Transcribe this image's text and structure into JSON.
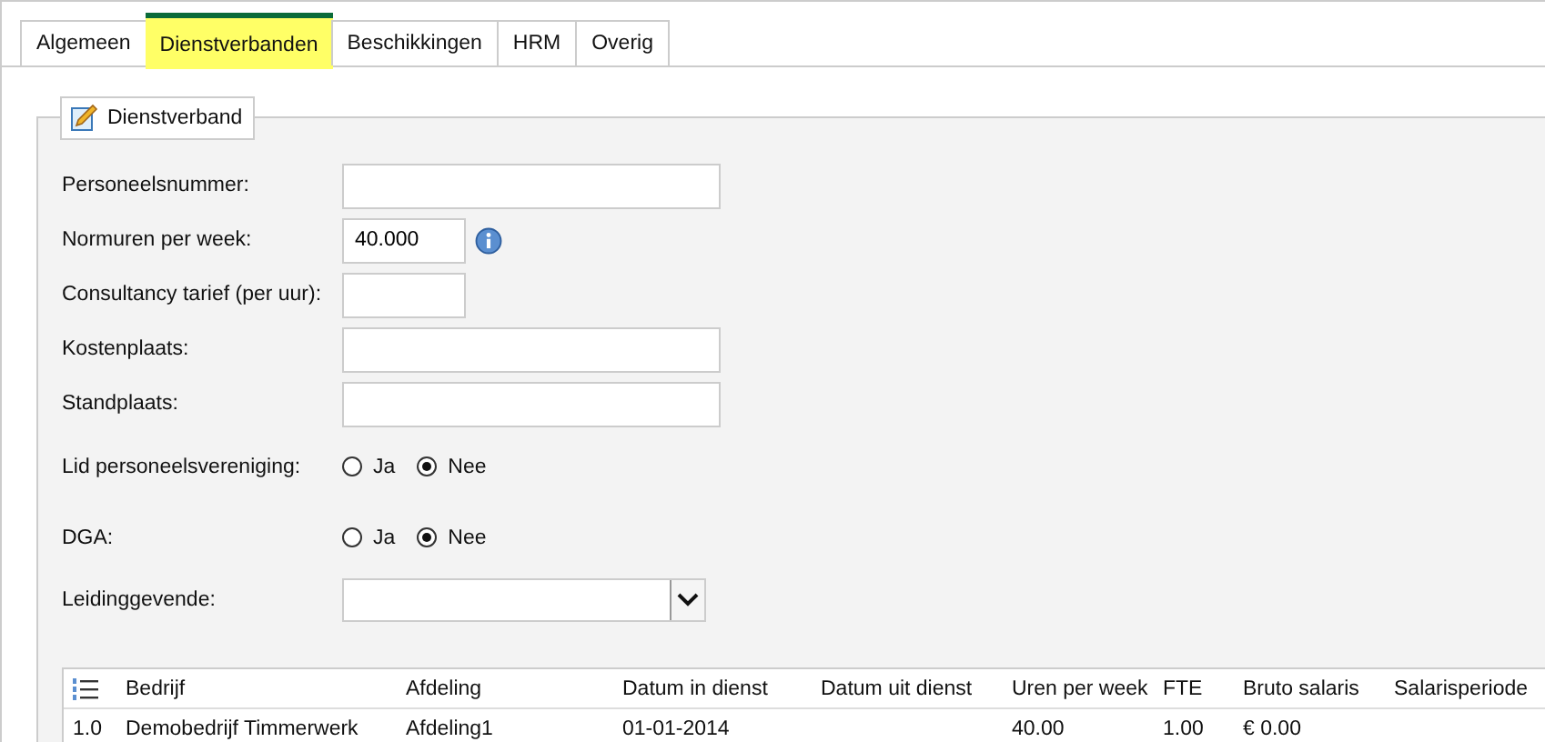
{
  "tabs": [
    {
      "label": "Algemeen",
      "selected": false
    },
    {
      "label": "Dienstverbanden",
      "selected": true
    },
    {
      "label": "Beschikkingen",
      "selected": false
    },
    {
      "label": "HRM",
      "selected": false
    },
    {
      "label": "Overig",
      "selected": false
    }
  ],
  "section": {
    "title": "Dienstverband"
  },
  "fields": [
    {
      "kind": "text",
      "label": "Personeelsnummer:"
    },
    {
      "kind": "short-text",
      "label": "Normuren per week:",
      "value": "40.000",
      "info": true
    },
    {
      "kind": "short-text",
      "label": "Consultancy tarief (per uur):"
    },
    {
      "kind": "text",
      "label": "Kostenplaats:"
    },
    {
      "kind": "text",
      "label": "Standplaats:"
    },
    {
      "kind": "radio",
      "label": "Lid personeelsvereniging:",
      "options": [
        {
          "label": "Ja",
          "selected": false
        },
        {
          "label": "Nee",
          "selected": true
        }
      ]
    },
    {
      "kind": "radio",
      "label": "DGA:",
      "options": [
        {
          "label": "Ja",
          "selected": false
        },
        {
          "label": "Nee",
          "selected": true
        }
      ]
    },
    {
      "kind": "select",
      "label": "Leidinggevende:"
    }
  ],
  "table": {
    "columns": [
      "Bedrijf",
      "Afdeling",
      "Datum in dienst",
      "Datum uit dienst",
      "Uren per week",
      "FTE",
      "Bruto salaris",
      "Salarisperiode"
    ],
    "rows": [
      {
        "number": "1.0",
        "cells": [
          "Demobedrijf Timmerwerk",
          "Afdeling1",
          "01-01-2014",
          "",
          "40.00",
          "1.00",
          "€ 0.00",
          ""
        ]
      }
    ]
  }
}
